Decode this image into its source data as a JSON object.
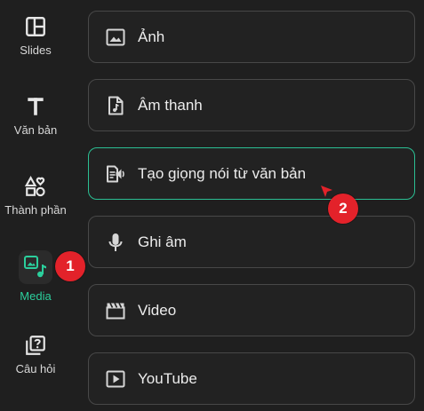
{
  "colors": {
    "background": "#1f1f1f",
    "card_border": "#484848",
    "accent": "#2bcf9c",
    "badge": "#e3222a"
  },
  "sidebar": {
    "items": [
      {
        "label": "Slides",
        "icon": "slides-layout-icon",
        "active": false
      },
      {
        "label": "Văn bản",
        "icon": "text-t-icon",
        "active": false
      },
      {
        "label": "Thành phần",
        "icon": "shapes-icon",
        "active": false
      },
      {
        "label": "Media",
        "icon": "media-image-music-icon",
        "active": true
      },
      {
        "label": "Câu hỏi",
        "icon": "question-cards-icon",
        "active": false
      }
    ]
  },
  "media_options": [
    {
      "label": "Ảnh",
      "icon": "image-icon"
    },
    {
      "label": "Âm thanh",
      "icon": "audio-file-icon"
    },
    {
      "label": "Tạo giọng nói từ văn bản",
      "icon": "text-to-speech-icon",
      "highlighted": true
    },
    {
      "label": "Ghi âm",
      "icon": "microphone-icon"
    },
    {
      "label": "Video",
      "icon": "video-clapper-icon"
    },
    {
      "label": "YouTube",
      "icon": "youtube-play-icon"
    }
  ],
  "annotations": {
    "step1": "1",
    "step2": "2"
  }
}
